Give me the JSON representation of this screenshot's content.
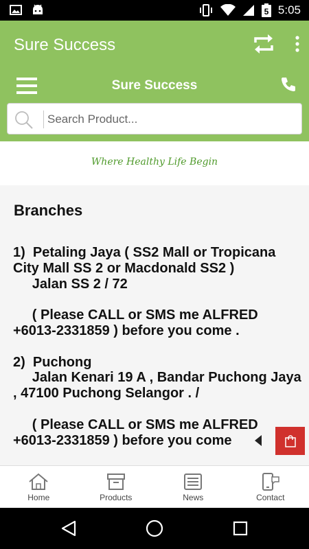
{
  "status_bar": {
    "time": "5:05",
    "battery_level": "5",
    "icons": [
      "image-icon",
      "android-icon",
      "vibrate-icon",
      "wifi-icon",
      "signal-icon",
      "battery-icon"
    ]
  },
  "app_bar": {
    "title": "Sure Success",
    "actions": [
      "refresh-icon",
      "more-vert-icon"
    ]
  },
  "sub_header": {
    "title": "Sure Success",
    "menu_icon": "hamburger-menu-icon",
    "phone_icon": "phone-icon"
  },
  "search": {
    "placeholder": "Search Product...",
    "value": ""
  },
  "tagline": "Where Healthy Life Begin",
  "content": {
    "heading": "Branches",
    "body": "1)  Petaling Jaya ( SS2 Mall or Tropicana City Mall SS 2 or Macdonald SS2 )\n     Jalan SS 2 / 72\n\n     ( Please CALL or SMS me ALFRED +6013-2331859 ) before you come .\n\n2)  Puchong\n     Jalan Kenari 19 A , Bandar Puchong Jaya , 47100 Puchong Selangor . /\n\n     ( Please CALL or SMS me ALFRED +6013-2331859 ) before you come"
  },
  "floating": {
    "cart_icon": "shopping-bag-icon",
    "arrow_icon": "collapse-left-icon"
  },
  "bottom_nav": [
    {
      "label": "Home",
      "icon": "home-icon"
    },
    {
      "label": "Products",
      "icon": "products-box-icon"
    },
    {
      "label": "News",
      "icon": "news-icon"
    },
    {
      "label": "Contact",
      "icon": "contact-phone-icon"
    }
  ],
  "colors": {
    "primary": "#8fc25f",
    "tagline": "#4f9a2b",
    "cart": "#d0312d"
  }
}
